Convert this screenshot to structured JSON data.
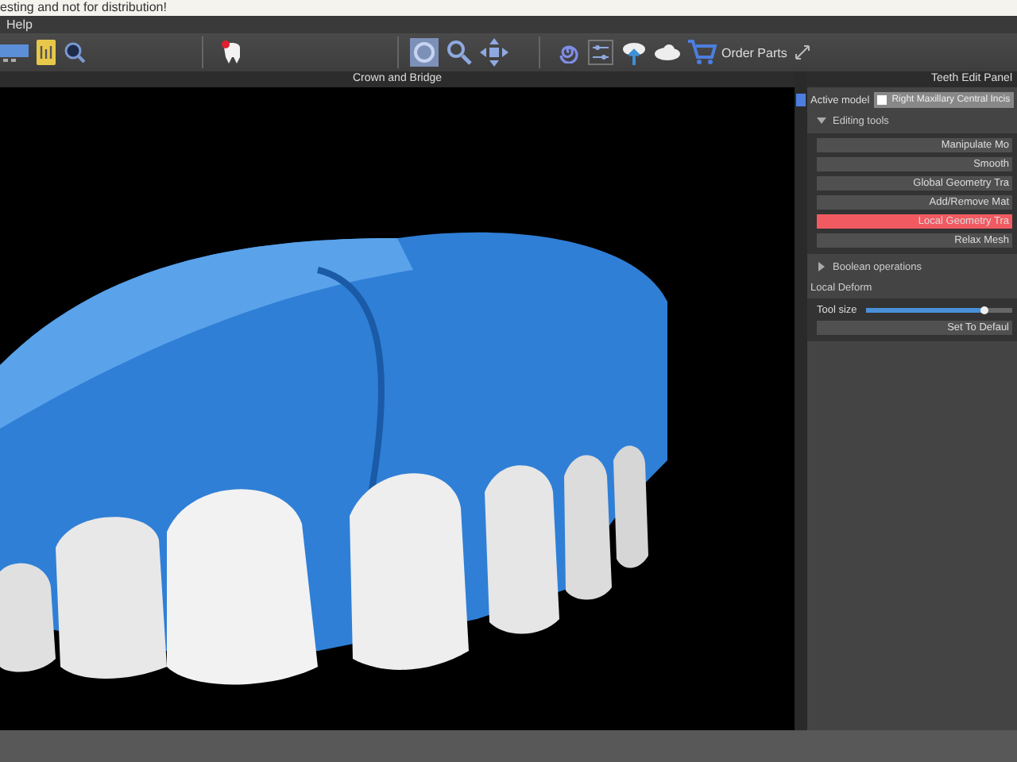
{
  "notice": "esting and not for distribution!",
  "menu": [
    "Help"
  ],
  "toolbar": {
    "order_label": "Order Parts"
  },
  "viewport": {
    "title": "Crown and Bridge"
  },
  "panel": {
    "title": "Teeth Edit Panel",
    "active_model_label": "Active model",
    "active_model": "Right Maxillary Central Incis",
    "active_model_checked": false,
    "sections": [
      {
        "title": "Editing tools",
        "expanded": true,
        "tools": [
          {
            "label": "Manipulate Mo",
            "selected": false
          },
          {
            "label": "Smooth",
            "selected": false
          },
          {
            "label": "Global Geometry Tra",
            "selected": false
          },
          {
            "label": "Add/Remove Mat",
            "selected": false
          },
          {
            "label": "Local Geometry Tra",
            "selected": true
          },
          {
            "label": "Relax Mesh",
            "selected": false
          }
        ]
      },
      {
        "title": "Boolean operations",
        "expanded": false
      }
    ],
    "deform": {
      "title": "Local Deform",
      "slider_label": "Tool size",
      "level": 0.8,
      "reset": "Set To Defaul"
    }
  }
}
